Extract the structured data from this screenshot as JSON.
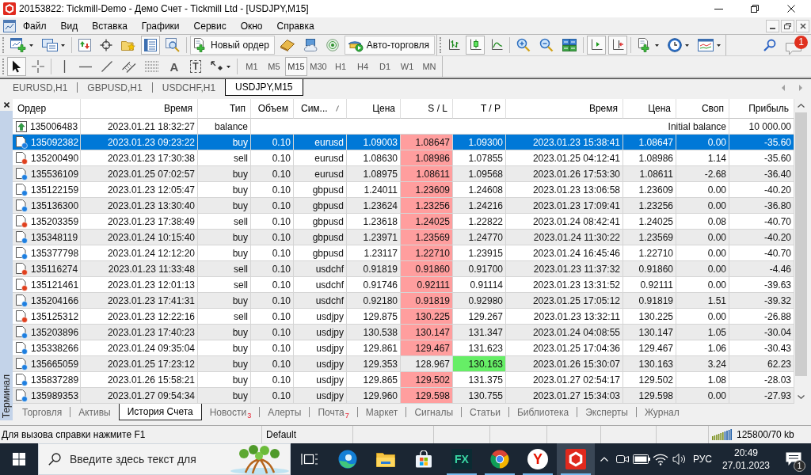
{
  "window": {
    "title": "20153822: Tickmill-Demo - Демо Счет - Tickmill Ltd - [USDJPY,M15]"
  },
  "menu": [
    "Файл",
    "Вид",
    "Вставка",
    "Графики",
    "Сервис",
    "Окно",
    "Справка"
  ],
  "toolbars": [
    {
      "groups": [
        [
          {
            "pressed": false,
            "dropdown": true
          },
          {
            "pressed": false,
            "dropdown": true
          }
        ],
        [
          {
            "pressed": false
          },
          {
            "pressed": false
          },
          {
            "pressed": false
          },
          {
            "pressed": true
          },
          {
            "pressed": false
          }
        ],
        [
          {
            "label": "Новый ордер",
            "pressed": false
          },
          {
            "pressed": false
          },
          {
            "pressed": false
          },
          {
            "pressed": false
          },
          {
            "label": "Авто-торговля",
            "pressed": false
          }
        ]
      ]
    },
    {
      "groups": [
        [
          {
            "pressed": false
          },
          {
            "pressed": true
          },
          {
            "pressed": false
          }
        ],
        [
          {
            "pressed": false
          },
          {
            "pressed": false
          },
          {
            "pressed": false
          }
        ],
        [
          {
            "pressed": true
          },
          {
            "pressed": true
          }
        ],
        [
          {
            "pressed": false,
            "dropdown": true
          },
          {
            "pressed": false,
            "dropdown": true
          },
          {
            "pressed": false,
            "dropdown": true
          }
        ]
      ]
    }
  ],
  "message_count": "1",
  "drawing_tools": {
    "groups": [
      [
        {
          "pressed": true
        },
        {
          "pressed": false
        }
      ],
      [
        {
          "pressed": false
        },
        {
          "pressed": false
        },
        {
          "pressed": false
        },
        {
          "pressed": false
        },
        {
          "pressed": false
        },
        {
          "pressed": false,
          "label": "A"
        },
        {
          "pressed": false,
          "label": "T"
        },
        {
          "pressed": false,
          "dropdown": true
        }
      ]
    ]
  },
  "timeframes": [
    {
      "label": "M1",
      "selected": false
    },
    {
      "label": "M5",
      "selected": false
    },
    {
      "label": "M15",
      "selected": true
    },
    {
      "label": "M30",
      "selected": false
    },
    {
      "label": "H1",
      "selected": false
    },
    {
      "label": "H4",
      "selected": false
    },
    {
      "label": "D1",
      "selected": false
    },
    {
      "label": "W1",
      "selected": false
    },
    {
      "label": "MN",
      "selected": false
    }
  ],
  "chart_tabs": [
    {
      "label": "EURUSD,H1",
      "selected": false
    },
    {
      "label": "GBPUSD,H1",
      "selected": false
    },
    {
      "label": "USDCHF,H1",
      "selected": false
    },
    {
      "label": "USDJPY,M15",
      "selected": true
    }
  ],
  "terminal": {
    "label": "Терминал",
    "table": {
      "columns": [
        {
          "label": "Ордер",
          "sorted": false
        },
        {
          "label": "Время",
          "sorted": false
        },
        {
          "label": "Тип",
          "sorted": false
        },
        {
          "label": "Объем",
          "sorted": false
        },
        {
          "label": "Сим...",
          "sorted": true
        },
        {
          "label": "Цена",
          "sorted": false
        },
        {
          "label": "S / L",
          "sorted": false
        },
        {
          "label": "T / P",
          "sorted": false
        },
        {
          "label": "Время",
          "sorted": false
        },
        {
          "label": "Цена",
          "sorted": false
        },
        {
          "label": "Своп",
          "sorted": false
        },
        {
          "label": "Прибыль",
          "sorted": false
        }
      ],
      "rows": [
        {
          "kind": "balance",
          "order": "135006483",
          "time": "2023.01.21 18:32:27",
          "type": "balance",
          "comment": "Initial balance",
          "profit": "10 000.00",
          "selected": false
        },
        {
          "kind": "buy",
          "order": "135092382",
          "time": "2023.01.23 09:23:22",
          "type": "buy",
          "volume": "0.10",
          "symbol": "eurusd",
          "price": "1.09003",
          "sl": "1.08647",
          "tp": "1.09300",
          "close_time": "2023.01.23 15:38:41",
          "close_price": "1.08647",
          "swap": "0.00",
          "profit": "-35.60",
          "sl_hit": true,
          "tp_hit": false,
          "selected": true
        },
        {
          "kind": "sell",
          "order": "135200490",
          "time": "2023.01.23 17:30:38",
          "type": "sell",
          "volume": "0.10",
          "symbol": "eurusd",
          "price": "1.08630",
          "sl": "1.08986",
          "tp": "1.07855",
          "close_time": "2023.01.25 04:12:41",
          "close_price": "1.08986",
          "swap": "1.14",
          "profit": "-35.60",
          "sl_hit": true,
          "tp_hit": false,
          "selected": false
        },
        {
          "kind": "buy",
          "order": "135536109",
          "time": "2023.01.25 07:02:57",
          "type": "buy",
          "volume": "0.10",
          "symbol": "eurusd",
          "price": "1.08975",
          "sl": "1.08611",
          "tp": "1.09568",
          "close_time": "2023.01.26 17:53:30",
          "close_price": "1.08611",
          "swap": "-2.68",
          "profit": "-36.40",
          "sl_hit": true,
          "tp_hit": false,
          "selected": false
        },
        {
          "kind": "buy",
          "order": "135122159",
          "time": "2023.01.23 12:05:47",
          "type": "buy",
          "volume": "0.10",
          "symbol": "gbpusd",
          "price": "1.24011",
          "sl": "1.23609",
          "tp": "1.24608",
          "close_time": "2023.01.23 13:06:58",
          "close_price": "1.23609",
          "swap": "0.00",
          "profit": "-40.20",
          "sl_hit": true,
          "tp_hit": false,
          "selected": false
        },
        {
          "kind": "buy",
          "order": "135136300",
          "time": "2023.01.23 13:30:40",
          "type": "buy",
          "volume": "0.10",
          "symbol": "gbpusd",
          "price": "1.23624",
          "sl": "1.23256",
          "tp": "1.24216",
          "close_time": "2023.01.23 17:09:41",
          "close_price": "1.23256",
          "swap": "0.00",
          "profit": "-36.80",
          "sl_hit": true,
          "tp_hit": false,
          "selected": false
        },
        {
          "kind": "sell",
          "order": "135203359",
          "time": "2023.01.23 17:38:49",
          "type": "sell",
          "volume": "0.10",
          "symbol": "gbpusd",
          "price": "1.23618",
          "sl": "1.24025",
          "tp": "1.22822",
          "close_time": "2023.01.24 08:42:41",
          "close_price": "1.24025",
          "swap": "0.08",
          "profit": "-40.70",
          "sl_hit": true,
          "tp_hit": false,
          "selected": false
        },
        {
          "kind": "buy",
          "order": "135348119",
          "time": "2023.01.24 10:15:40",
          "type": "buy",
          "volume": "0.10",
          "symbol": "gbpusd",
          "price": "1.23971",
          "sl": "1.23569",
          "tp": "1.24770",
          "close_time": "2023.01.24 11:30:22",
          "close_price": "1.23569",
          "swap": "0.00",
          "profit": "-40.20",
          "sl_hit": true,
          "tp_hit": false,
          "selected": false
        },
        {
          "kind": "buy",
          "order": "135377798",
          "time": "2023.01.24 12:12:20",
          "type": "buy",
          "volume": "0.10",
          "symbol": "gbpusd",
          "price": "1.23117",
          "sl": "1.22710",
          "tp": "1.23915",
          "close_time": "2023.01.24 16:45:46",
          "close_price": "1.22710",
          "swap": "0.00",
          "profit": "-40.70",
          "sl_hit": true,
          "tp_hit": false,
          "selected": false
        },
        {
          "kind": "sell",
          "order": "135116274",
          "time": "2023.01.23 11:33:48",
          "type": "sell",
          "volume": "0.10",
          "symbol": "usdchf",
          "price": "0.91819",
          "sl": "0.91860",
          "tp": "0.91700",
          "close_time": "2023.01.23 11:37:32",
          "close_price": "0.91860",
          "swap": "0.00",
          "profit": "-4.46",
          "sl_hit": true,
          "tp_hit": false,
          "selected": false
        },
        {
          "kind": "sell",
          "order": "135121461",
          "time": "2023.01.23 12:01:13",
          "type": "sell",
          "volume": "0.10",
          "symbol": "usdchf",
          "price": "0.91746",
          "sl": "0.92111",
          "tp": "0.91114",
          "close_time": "2023.01.23 13:31:52",
          "close_price": "0.92111",
          "swap": "0.00",
          "profit": "-39.63",
          "sl_hit": true,
          "tp_hit": false,
          "selected": false
        },
        {
          "kind": "buy",
          "order": "135204166",
          "time": "2023.01.23 17:41:31",
          "type": "buy",
          "volume": "0.10",
          "symbol": "usdchf",
          "price": "0.92180",
          "sl": "0.91819",
          "tp": "0.92980",
          "close_time": "2023.01.25 17:05:12",
          "close_price": "0.91819",
          "swap": "1.51",
          "profit": "-39.32",
          "sl_hit": true,
          "tp_hit": false,
          "selected": false
        },
        {
          "kind": "sell",
          "order": "135125312",
          "time": "2023.01.23 12:22:16",
          "type": "sell",
          "volume": "0.10",
          "symbol": "usdjpy",
          "price": "129.875",
          "sl": "130.225",
          "tp": "129.267",
          "close_time": "2023.01.23 13:32:11",
          "close_price": "130.225",
          "swap": "0.00",
          "profit": "-26.88",
          "sl_hit": true,
          "tp_hit": false,
          "selected": false
        },
        {
          "kind": "buy",
          "order": "135203896",
          "time": "2023.01.23 17:40:23",
          "type": "buy",
          "volume": "0.10",
          "symbol": "usdjpy",
          "price": "130.538",
          "sl": "130.147",
          "tp": "131.347",
          "close_time": "2023.01.24 04:08:55",
          "close_price": "130.147",
          "swap": "1.05",
          "profit": "-30.04",
          "sl_hit": true,
          "tp_hit": false,
          "selected": false
        },
        {
          "kind": "buy",
          "order": "135338266",
          "time": "2023.01.24 09:35:04",
          "type": "buy",
          "volume": "0.10",
          "symbol": "usdjpy",
          "price": "129.861",
          "sl": "129.467",
          "tp": "131.623",
          "close_time": "2023.01.25 17:04:36",
          "close_price": "129.467",
          "swap": "1.06",
          "profit": "-30.43",
          "sl_hit": true,
          "tp_hit": false,
          "selected": false
        },
        {
          "kind": "buy",
          "order": "135665059",
          "time": "2023.01.25 17:23:12",
          "type": "buy",
          "volume": "0.10",
          "symbol": "usdjpy",
          "price": "129.353",
          "sl": "128.967",
          "tp": "130.163",
          "close_time": "2023.01.26 15:30:07",
          "close_price": "130.163",
          "swap": "3.24",
          "profit": "62.23",
          "sl_hit": false,
          "tp_hit": true,
          "selected": false
        },
        {
          "kind": "buy",
          "order": "135837289",
          "time": "2023.01.26 15:58:21",
          "type": "buy",
          "volume": "0.10",
          "symbol": "usdjpy",
          "price": "129.865",
          "sl": "129.502",
          "tp": "131.375",
          "close_time": "2023.01.27 02:54:17",
          "close_price": "129.502",
          "swap": "1.08",
          "profit": "-28.03",
          "sl_hit": true,
          "tp_hit": false,
          "selected": false
        },
        {
          "kind": "buy",
          "order": "135989353",
          "time": "2023.01.27 09:54:34",
          "type": "buy",
          "volume": "0.10",
          "symbol": "usdjpy",
          "price": "129.960",
          "sl": "129.598",
          "tp": "130.755",
          "close_time": "2023.01.27 15:34:03",
          "close_price": "129.598",
          "swap": "0.00",
          "profit": "-27.93",
          "sl_hit": true,
          "tp_hit": false,
          "selected": false
        }
      ]
    },
    "tabs": [
      {
        "label": "Торговля",
        "selected": false
      },
      {
        "label": "Активы",
        "selected": false
      },
      {
        "label": "История Счета",
        "selected": true
      },
      {
        "label": "Новости",
        "badge": "3",
        "selected": false
      },
      {
        "label": "Алерты",
        "selected": false
      },
      {
        "label": "Почта",
        "badge": "7",
        "selected": false
      },
      {
        "label": "Маркет",
        "selected": false
      },
      {
        "label": "Сигналы",
        "selected": false
      },
      {
        "label": "Статьи",
        "selected": false
      },
      {
        "label": "Библиотека",
        "selected": false
      },
      {
        "label": "Эксперты",
        "selected": false
      },
      {
        "label": "Журнал",
        "selected": false
      }
    ]
  },
  "status_bar": {
    "help": "Для вызова справки нажмите F1",
    "profile": "Default",
    "traffic": "125800/70 kb"
  },
  "taskbar": {
    "search": {
      "placeholder": "Введите здесь текст для"
    },
    "apps": [
      {
        "kind": "task-view",
        "running": false,
        "selected": false
      },
      {
        "kind": "swirl",
        "running": false,
        "selected": false
      },
      {
        "kind": "folder",
        "running": false,
        "selected": false
      },
      {
        "kind": "bag",
        "running": false,
        "selected": false
      },
      {
        "kind": "tile",
        "label": "FX",
        "running": true,
        "selected": false
      },
      {
        "kind": "segmented-circle",
        "running": true,
        "selected": false
      },
      {
        "kind": "letter-circle",
        "label": "Y",
        "running": true,
        "selected": false
      },
      {
        "kind": "hexagon",
        "running": true,
        "selected": true
      }
    ],
    "tray": {
      "language": "РУС",
      "time": "20:49",
      "date": "27.01.2023",
      "notification_count": "1"
    }
  }
}
